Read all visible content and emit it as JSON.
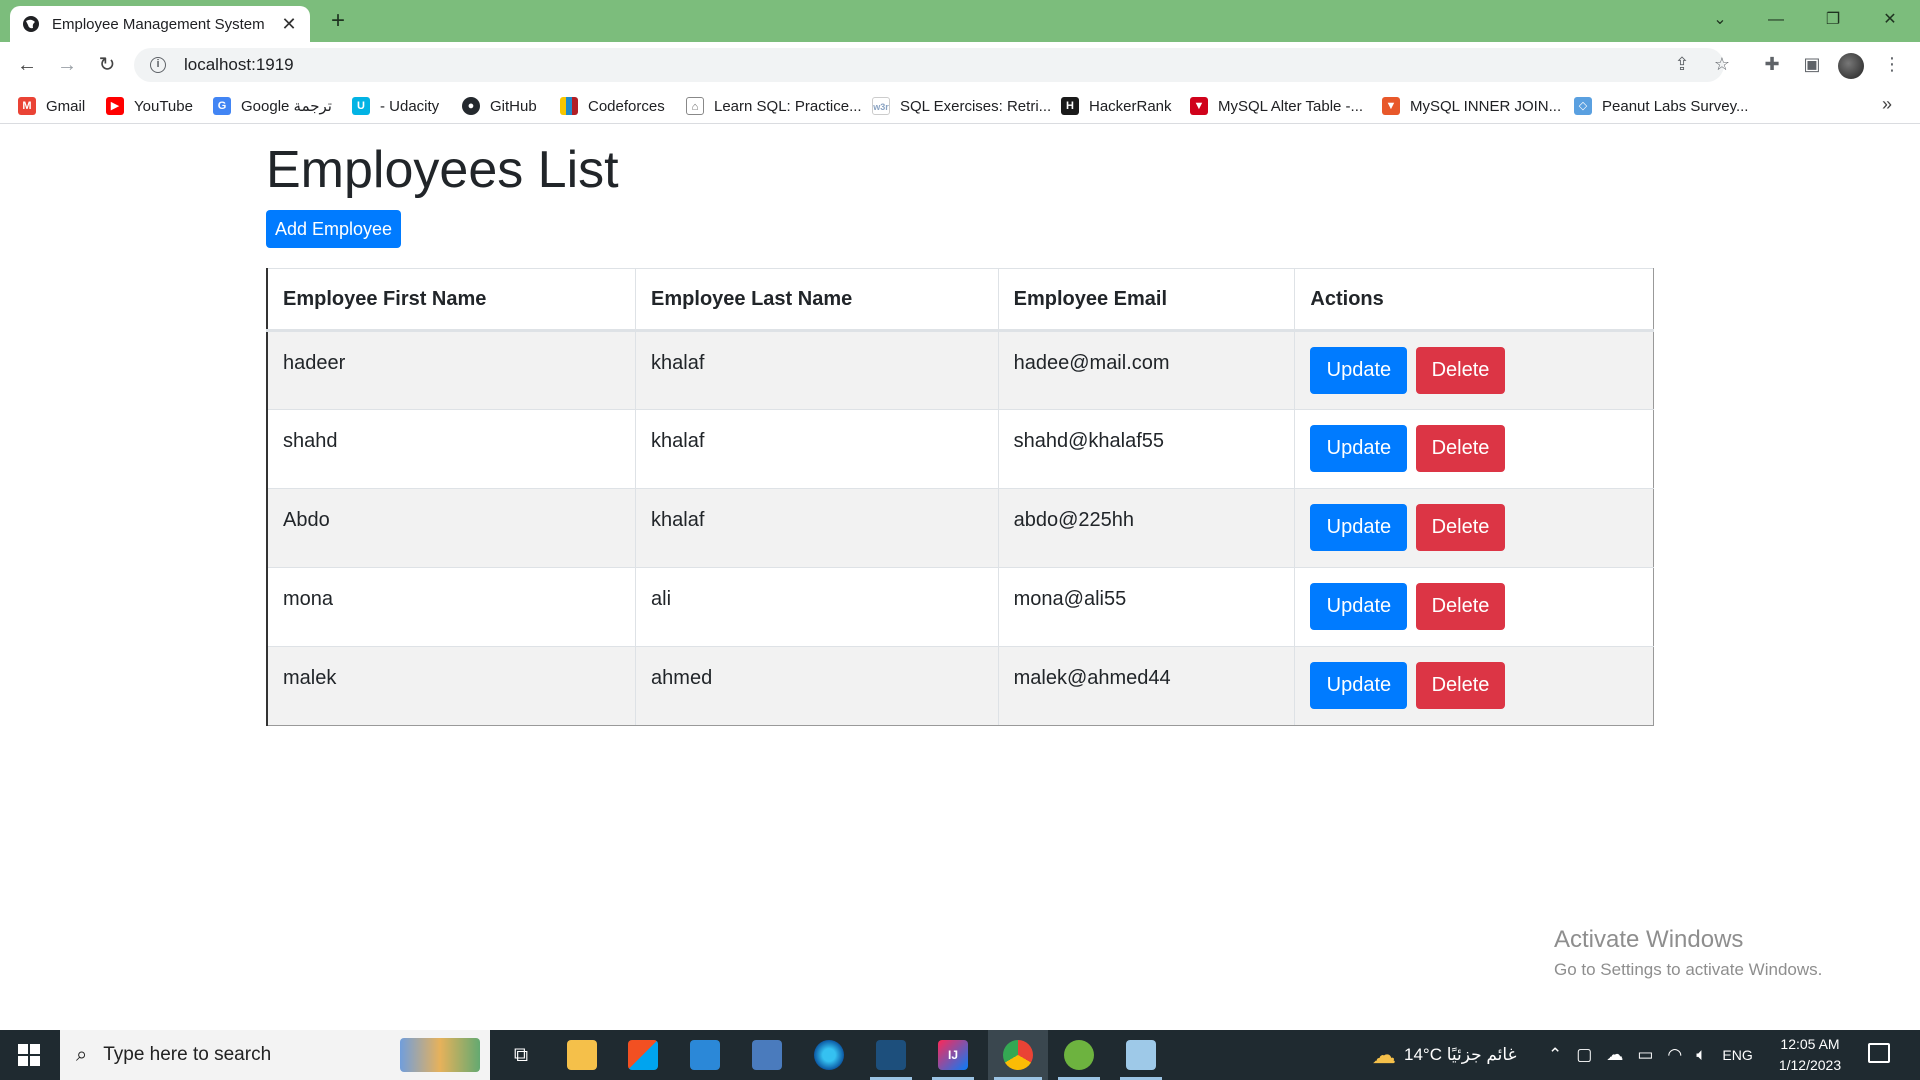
{
  "browser": {
    "tab_title": "Employee Management System",
    "url": "localhost:1919",
    "bookmarks": [
      {
        "label": "Gmail",
        "icon": "gmail-icon",
        "color": "#ea4335"
      },
      {
        "label": "YouTube",
        "icon": "youtube-icon",
        "color": "#ff0000"
      },
      {
        "label": "Google ترجمة",
        "icon": "google-translate-icon",
        "color": "#4285f4"
      },
      {
        "label": "- Udacity",
        "icon": "udacity-icon",
        "color": "#02b3e4"
      },
      {
        "label": "GitHub",
        "icon": "github-icon",
        "color": "#24292e"
      },
      {
        "label": "Codeforces",
        "icon": "codeforces-icon",
        "color": "#1f8acb"
      },
      {
        "label": "Learn SQL: Practice...",
        "icon": "home-icon",
        "color": "#666666"
      },
      {
        "label": "SQL Exercises: Retri...",
        "icon": "w3resource-icon",
        "color": "#8aa3c2"
      },
      {
        "label": "HackerRank",
        "icon": "hackerrank-icon",
        "color": "#1a1a1a"
      },
      {
        "label": "MySQL Alter Table -...",
        "icon": "mysql-tutorial-icon",
        "color": "#d0021b"
      },
      {
        "label": "MySQL INNER JOIN...",
        "icon": "mysql-tutorial-icon",
        "color": "#e8582a"
      },
      {
        "label": "Peanut Labs Survey...",
        "icon": "peanut-labs-icon",
        "color": "#5aa0e0"
      }
    ]
  },
  "page": {
    "title": "Employees List",
    "add_button": "Add Employee",
    "columns": [
      "Employee First Name",
      "Employee Last Name",
      "Employee Email",
      "Actions"
    ],
    "rows": [
      {
        "first": "hadeer",
        "last": "khalaf",
        "email": "hadee@mail.com"
      },
      {
        "first": "shahd",
        "last": "khalaf",
        "email": "shahd@khalaf55"
      },
      {
        "first": "Abdo",
        "last": "khalaf",
        "email": "abdo@225hh"
      },
      {
        "first": "mona",
        "last": "ali",
        "email": "mona@ali55"
      },
      {
        "first": "malek",
        "last": "ahmed",
        "email": "malek@ahmed44"
      }
    ],
    "update_label": "Update",
    "delete_label": "Delete"
  },
  "watermark": {
    "line1": "Activate Windows",
    "line2": "Go to Settings to activate Windows."
  },
  "taskbar": {
    "search_placeholder": "Type here to search",
    "weather": "14°C  غائم جزئيًا",
    "language": "ENG",
    "time": "12:05 AM",
    "date": "1/12/2023"
  },
  "colors": {
    "primary": "#007bff",
    "danger": "#dc3545",
    "chrome_frame": "#7cbd7c"
  }
}
